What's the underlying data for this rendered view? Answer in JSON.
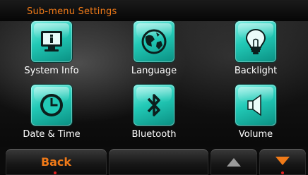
{
  "header": {
    "title": "Sub-menu Settings"
  },
  "tiles": [
    {
      "label": "System Info",
      "icon": "monitor-info-icon"
    },
    {
      "label": "Language",
      "icon": "globe-icon"
    },
    {
      "label": "Backlight",
      "icon": "lightbulb-icon"
    },
    {
      "label": "Date & Time",
      "icon": "clock-icon"
    },
    {
      "label": "Bluetooth",
      "icon": "bluetooth-icon"
    },
    {
      "label": "Volume",
      "icon": "speaker-icon"
    }
  ],
  "footer": {
    "back_label": "Back",
    "scroll_up_icon": "triangle-up-icon",
    "scroll_down_icon": "triangle-down-icon"
  },
  "colors": {
    "accent": "#f07a18",
    "tile": "#22c9b6",
    "indicator": "#e02020"
  }
}
